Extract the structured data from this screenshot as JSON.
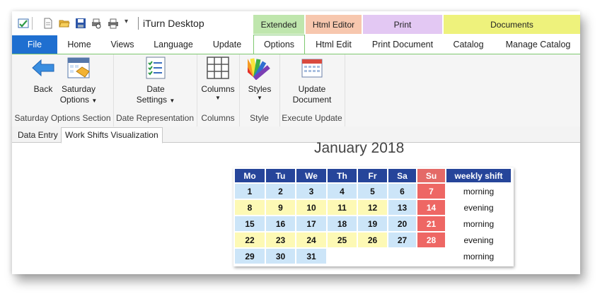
{
  "app": {
    "title": "iTurn Desktop"
  },
  "context_groups": [
    {
      "label": "Extended",
      "color": "#bfe6ad"
    },
    {
      "label": "Html Editor",
      "color": "#f7c7ae"
    },
    {
      "label": "Print",
      "color": "#e3c8f3"
    },
    {
      "label": "Documents",
      "color": "#eef27c"
    }
  ],
  "tabs": {
    "file": "File",
    "home": "Home",
    "views": "Views",
    "language": "Language",
    "update": "Update",
    "options": "Options",
    "html_edit": "Html Edit",
    "print_document": "Print Document",
    "catalog": "Catalog",
    "manage_catalog": "Manage Catalog"
  },
  "ribbon": {
    "back": "Back",
    "saturday_options": [
      "Saturday",
      "Options"
    ],
    "group_saturday": "Saturday Options Section",
    "date_settings": [
      "Date",
      "Settings"
    ],
    "group_date": "Date Representation",
    "columns": "Columns",
    "group_columns": "Columns",
    "styles": "Styles",
    "group_style": "Style",
    "update_document": [
      "Update",
      "Document"
    ],
    "group_execute": "Execute Update"
  },
  "doc_tabs": [
    "Data Entry",
    "Work Shifts Visualization"
  ],
  "calendar": {
    "title": "January 2018",
    "headers": [
      "Mo",
      "Tu",
      "We",
      "Th",
      "Fr",
      "Sa",
      "Su",
      "weekly shift"
    ],
    "colors": {
      "header": "#26459a",
      "sunday": "#e46a67",
      "morning_cell": "#cce5f8",
      "evening_cell": "#fdf9b5",
      "sunday_cell": "#ee6764"
    },
    "weeks": [
      {
        "days": [
          "1",
          "2",
          "3",
          "4",
          "5",
          "6",
          "7"
        ],
        "shift": "morning"
      },
      {
        "days": [
          "8",
          "9",
          "10",
          "11",
          "12",
          "13",
          "14"
        ],
        "shift": "evening"
      },
      {
        "days": [
          "15",
          "16",
          "17",
          "18",
          "19",
          "20",
          "21"
        ],
        "shift": "morning"
      },
      {
        "days": [
          "22",
          "23",
          "24",
          "25",
          "26",
          "27",
          "28"
        ],
        "shift": "evening"
      },
      {
        "days": [
          "29",
          "30",
          "31",
          "",
          "",
          "",
          ""
        ],
        "shift": "morning"
      }
    ]
  }
}
